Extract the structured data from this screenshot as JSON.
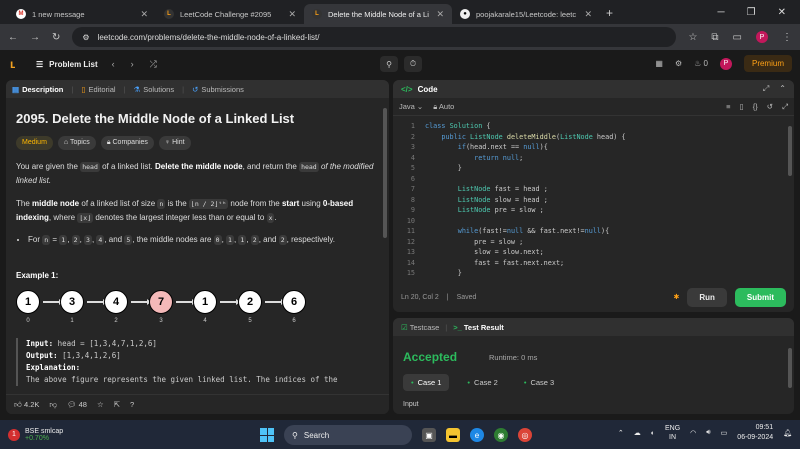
{
  "browser": {
    "tabs": [
      {
        "label": "1 new message",
        "active": false
      },
      {
        "label": "LeetCode Challenge #2095",
        "active": false
      },
      {
        "label": "Delete the Middle Node of a Li",
        "active": true
      },
      {
        "label": "poojakarale15/Leetcode: leetc",
        "active": false
      }
    ],
    "url": "leetcode.com/problems/delete-the-middle-node-of-a-linked-list/",
    "profile_initial": "P"
  },
  "lc_nav": {
    "problem_list": "Problem List",
    "streak": "0",
    "profile_initial": "P",
    "premium": "Premium"
  },
  "left_tabs": {
    "description": "Description",
    "editorial": "Editorial",
    "solutions": "Solutions",
    "submissions": "Submissions"
  },
  "problem": {
    "title": "2095. Delete the Middle Node of a Linked List",
    "difficulty": "Medium",
    "topics": "Topics",
    "companies": "Companies",
    "hint": "Hint",
    "p1_a": "You are given the ",
    "p1_code1": "head",
    "p1_b": " of a linked list. ",
    "p1_bold": "Delete the middle node",
    "p1_c": ", and return the ",
    "p1_code2": "head",
    "p1_d": " of the modified linked list.",
    "p2_a": "The ",
    "p2_bold1": "middle node",
    "p2_b": " of a linked list of size ",
    "p2_code1": "n",
    "p2_c": " is the ",
    "p2_code2": "⌊n / 2⌋ᵗʰ",
    "p2_d": " node from the ",
    "p2_bold2": "start",
    "p2_e": " using ",
    "p2_bold3": "0-based indexing",
    "p2_f": ", where ",
    "p2_code3": "⌊x⌋",
    "p2_g": " denotes the largest integer less than or equal to ",
    "p2_code4": "x",
    "p2_h": ".",
    "bullet_a": "For ",
    "bullet_n": "n",
    "bullet_b": " = ",
    "bullet_vals": [
      "1",
      "2",
      "3",
      "4"
    ],
    "bullet_c": ", and ",
    "bullet_last": "5",
    "bullet_d": ", the middle nodes are ",
    "bullet_mid": [
      "0",
      "1",
      "1",
      "2"
    ],
    "bullet_e": ", and ",
    "bullet_mid_last": "2",
    "bullet_f": ", respectively.",
    "example_title": "Example 1:",
    "nodes": [
      "1",
      "3",
      "4",
      "7",
      "1",
      "2",
      "6"
    ],
    "indices": [
      "0",
      "1",
      "2",
      "3",
      "4",
      "5",
      "6"
    ],
    "input_label": "Input:",
    "input_value": " head = [1,3,4,7,1,2,6]",
    "output_label": "Output:",
    "output_value": " [1,3,4,1,2,6]",
    "explanation_label": "Explanation:",
    "explanation_text": "The above figure represents the given linked list. The indices of the"
  },
  "left_footer": {
    "likes": "4.2K",
    "comments": "48"
  },
  "code_panel": {
    "title": "Code",
    "language": "Java",
    "mode": "Auto",
    "status": "Ln 20, Col 2",
    "saved": "Saved",
    "run": "Run",
    "submit": "Submit",
    "line_numbers": [
      "1",
      "2",
      "3",
      "4",
      "5",
      "6",
      "7",
      "8",
      "9",
      "10",
      "11",
      "12",
      "13",
      "14",
      "15"
    ]
  },
  "test_panel": {
    "testcase": "Testcase",
    "test_result": "Test Result",
    "verdict": "Accepted",
    "runtime": "Runtime: 0 ms",
    "cases": [
      "Case 1",
      "Case 2",
      "Case 3"
    ],
    "input_label": "Input"
  },
  "taskbar": {
    "stock_name": "BSE smlcap",
    "stock_change": "+0.70%",
    "search": "Search",
    "lang1": "ENG",
    "lang2": "IN",
    "time": "09:51",
    "date": "06-09-2024"
  }
}
